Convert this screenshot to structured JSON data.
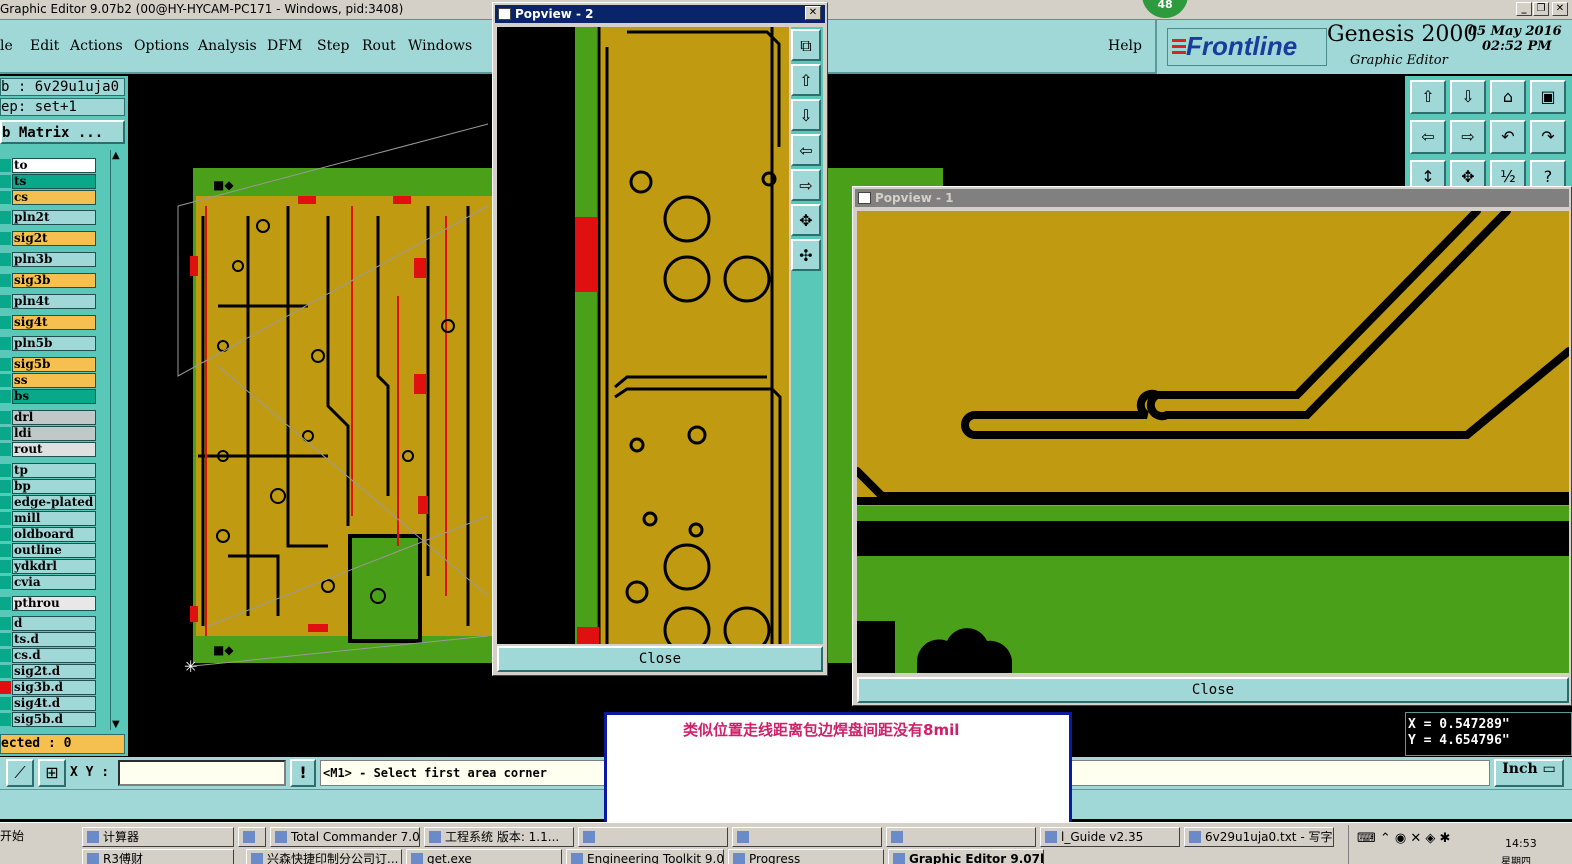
{
  "window": {
    "title": "Graphic Editor 9.07b2 (00@HY-HYCAM-PC171 - Windows, pid:3408)",
    "badge": "48"
  },
  "menu": [
    "le",
    "Edit",
    "Actions",
    "Options",
    "Analysis",
    "DFM",
    "Step",
    "Rout",
    "Windows"
  ],
  "help": "Help",
  "brand": {
    "logo": "Frontline",
    "product": "Genesis 2000",
    "subtitle": "Graphic Editor",
    "date": "05 May 2016",
    "time": "02:52 PM"
  },
  "left": {
    "job": "b : 6v29u1uja0",
    "step": "ep: set+1",
    "matrix": "b Matrix ...",
    "layers": [
      {
        "name": "to",
        "color": "#ffffff"
      },
      {
        "name": "ts",
        "color": "#0aa88a"
      },
      {
        "name": "cs",
        "color": "#f6c050"
      },
      {
        "name": "pln2t",
        "color": "#a0d8d8"
      },
      {
        "name": "sig2t",
        "color": "#f6c050"
      },
      {
        "name": "pln3b",
        "color": "#a0d8d8"
      },
      {
        "name": "sig3b",
        "color": "#f6c050"
      },
      {
        "name": "pln4t",
        "color": "#a0d8d8"
      },
      {
        "name": "sig4t",
        "color": "#f6c050"
      },
      {
        "name": "pln5b",
        "color": "#a0d8d8"
      },
      {
        "name": "sig5b",
        "color": "#f6c050"
      },
      {
        "name": "ss",
        "color": "#f6c050"
      },
      {
        "name": "bs",
        "color": "#0aa88a"
      },
      {
        "name": "drl",
        "color": "#c0c8c8"
      },
      {
        "name": "ldi",
        "color": "#c0c8c8"
      },
      {
        "name": "rout",
        "color": "#e0e0e0"
      },
      {
        "name": "tp",
        "color": "#a0d8d8"
      },
      {
        "name": "bp",
        "color": "#a0d8d8"
      },
      {
        "name": "edge-plated",
        "color": "#a0d8d8"
      },
      {
        "name": "mill",
        "color": "#a0d8d8"
      },
      {
        "name": "oldboard",
        "color": "#a0d8d8"
      },
      {
        "name": "outline",
        "color": "#a0d8d8"
      },
      {
        "name": "ydkdrl",
        "color": "#a0d8d8"
      },
      {
        "name": "cvia",
        "color": "#a0d8d8"
      },
      {
        "name": "pthrou",
        "color": "#e8e8e8"
      },
      {
        "name": "d",
        "color": "#a0d8d8"
      },
      {
        "name": "ts.d",
        "color": "#a0d8d8"
      },
      {
        "name": "cs.d",
        "color": "#a0d8d8"
      },
      {
        "name": "sig2t.d",
        "color": "#a0d8d8"
      },
      {
        "name": "sig3b.d",
        "color": "#a0d8d8"
      },
      {
        "name": "sig4t.d",
        "color": "#a0d8d8"
      },
      {
        "name": "sig5b.d",
        "color": "#a0d8d8"
      }
    ],
    "selected": "ected : 0"
  },
  "popview2": {
    "title": "Popview - 2",
    "close": "Close"
  },
  "popview1": {
    "title": "Popview - 1",
    "close": "Close"
  },
  "coords": {
    "x": "X = 0.547289\"",
    "y": "Y = 4.654796\""
  },
  "command": {
    "xy_label": "X Y :",
    "xy_value": "",
    "prompt": "<M1> - Select first area corner",
    "units": "Inch"
  },
  "note": "类似位置走线距离包边焊盘间距没有8mil",
  "taskbar": {
    "row1": [
      "计算器",
      "",
      "Total Commander 7.0 ...",
      "工程系统  版本: 1.1...",
      "",
      "",
      "",
      "l_Guide v2.35",
      "6v29u1uja0.txt - 写字板"
    ],
    "row2": [
      "R3傅财",
      "兴森快捷印制分公司订...",
      "get.exe",
      "Engineering Toolkit 9.07...",
      "Progress",
      "Graphic Editor 9.07b2..."
    ],
    "start": "开始",
    "clock": "14:53",
    "weekday": "星期四"
  }
}
